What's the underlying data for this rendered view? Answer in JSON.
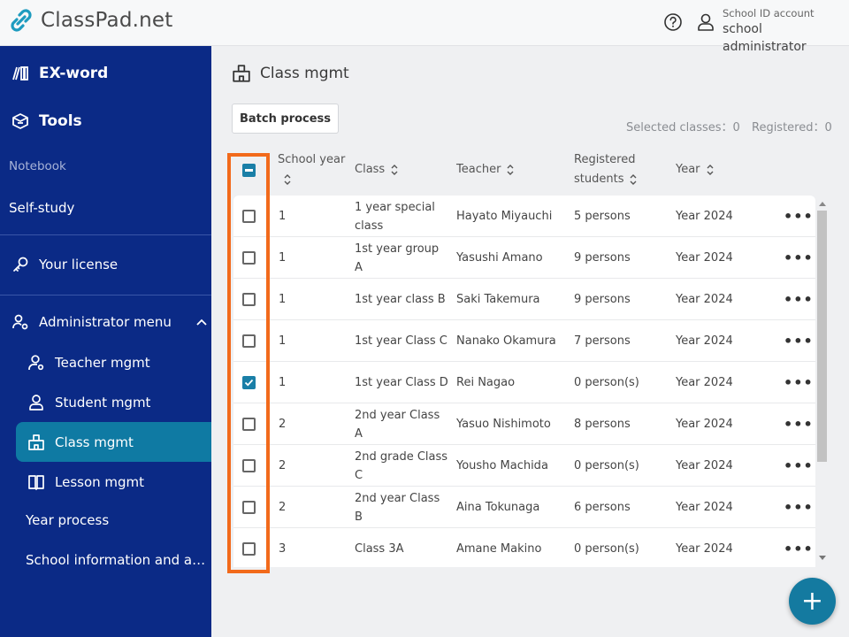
{
  "app": {
    "title": "ClassPad.net"
  },
  "header": {
    "account_type": "School ID account",
    "account_name": "school administrator"
  },
  "sidebar": {
    "ex_word": "EX-word",
    "tools": "Tools",
    "notebook_section": "Notebook",
    "self_study": "Self-study",
    "your_license": "Your license",
    "admin_menu": "Administrator menu",
    "admin_items": [
      {
        "label": "Teacher mgmt",
        "icon": "teacher-icon"
      },
      {
        "label": "Student mgmt",
        "icon": "user-icon"
      },
      {
        "label": "Class mgmt",
        "icon": "building-icon",
        "active": true
      },
      {
        "label": "Lesson mgmt",
        "icon": "book-icon"
      }
    ],
    "year_process": "Year process",
    "school_info": "School information and a…"
  },
  "main": {
    "page_title": "Class mgmt",
    "batch_button": "Batch process",
    "selected_classes": "Selected classes：0",
    "registered": "Registered：0",
    "columns": {
      "school_year": "School year",
      "class": "Class",
      "teacher": "Teacher",
      "registered_line1": "Registered",
      "registered_line2": "students",
      "year": "Year"
    },
    "rows": [
      {
        "school_year": "1",
        "class_l1": "1 year special",
        "class_l2": "class",
        "teacher": "Hayato Miyauchi",
        "students": "5 persons",
        "year": "Year 2024",
        "checked": false
      },
      {
        "school_year": "1",
        "class_l1": "1st year group",
        "class_l2": "A",
        "teacher": "Yasushi Amano",
        "students": "9 persons",
        "year": "Year 2024",
        "checked": false
      },
      {
        "school_year": "1",
        "class_l1": "1st year class B",
        "class_l2": "",
        "teacher": "Saki Takemura",
        "students": "9 persons",
        "year": "Year 2024",
        "checked": false
      },
      {
        "school_year": "1",
        "class_l1": "1st year Class C",
        "class_l2": "",
        "teacher": "Nanako Okamura",
        "students": "7 persons",
        "year": "Year 2024",
        "checked": false
      },
      {
        "school_year": "1",
        "class_l1": "1st year Class D",
        "class_l2": "",
        "teacher": "Rei Nagao",
        "students": "0 person(s)",
        "year": "Year 2024",
        "checked": true
      },
      {
        "school_year": "2",
        "class_l1": "2nd year Class",
        "class_l2": "A",
        "teacher": "Yasuo Nishimoto",
        "students": "8 persons",
        "year": "Year 2024",
        "checked": false
      },
      {
        "school_year": "2",
        "class_l1": "2nd grade Class",
        "class_l2": "C",
        "teacher": "Yousho Machida",
        "students": "0 person(s)",
        "year": "Year 2024",
        "checked": false
      },
      {
        "school_year": "2",
        "class_l1": "2nd year Class",
        "class_l2": "B",
        "teacher": "Aina Tokunaga",
        "students": "6 persons",
        "year": "Year 2024",
        "checked": false
      },
      {
        "school_year": "3",
        "class_l1": "Class 3A",
        "class_l2": "",
        "teacher": "Amane Makino",
        "students": "0 person(s)",
        "year": "Year 2024",
        "checked": false
      }
    ],
    "more_label": "•••",
    "fab_label": "+"
  },
  "colors": {
    "sidebar_bg": "#0b2a86",
    "accent": "#147aa0",
    "highlight": "#f26a1b"
  }
}
